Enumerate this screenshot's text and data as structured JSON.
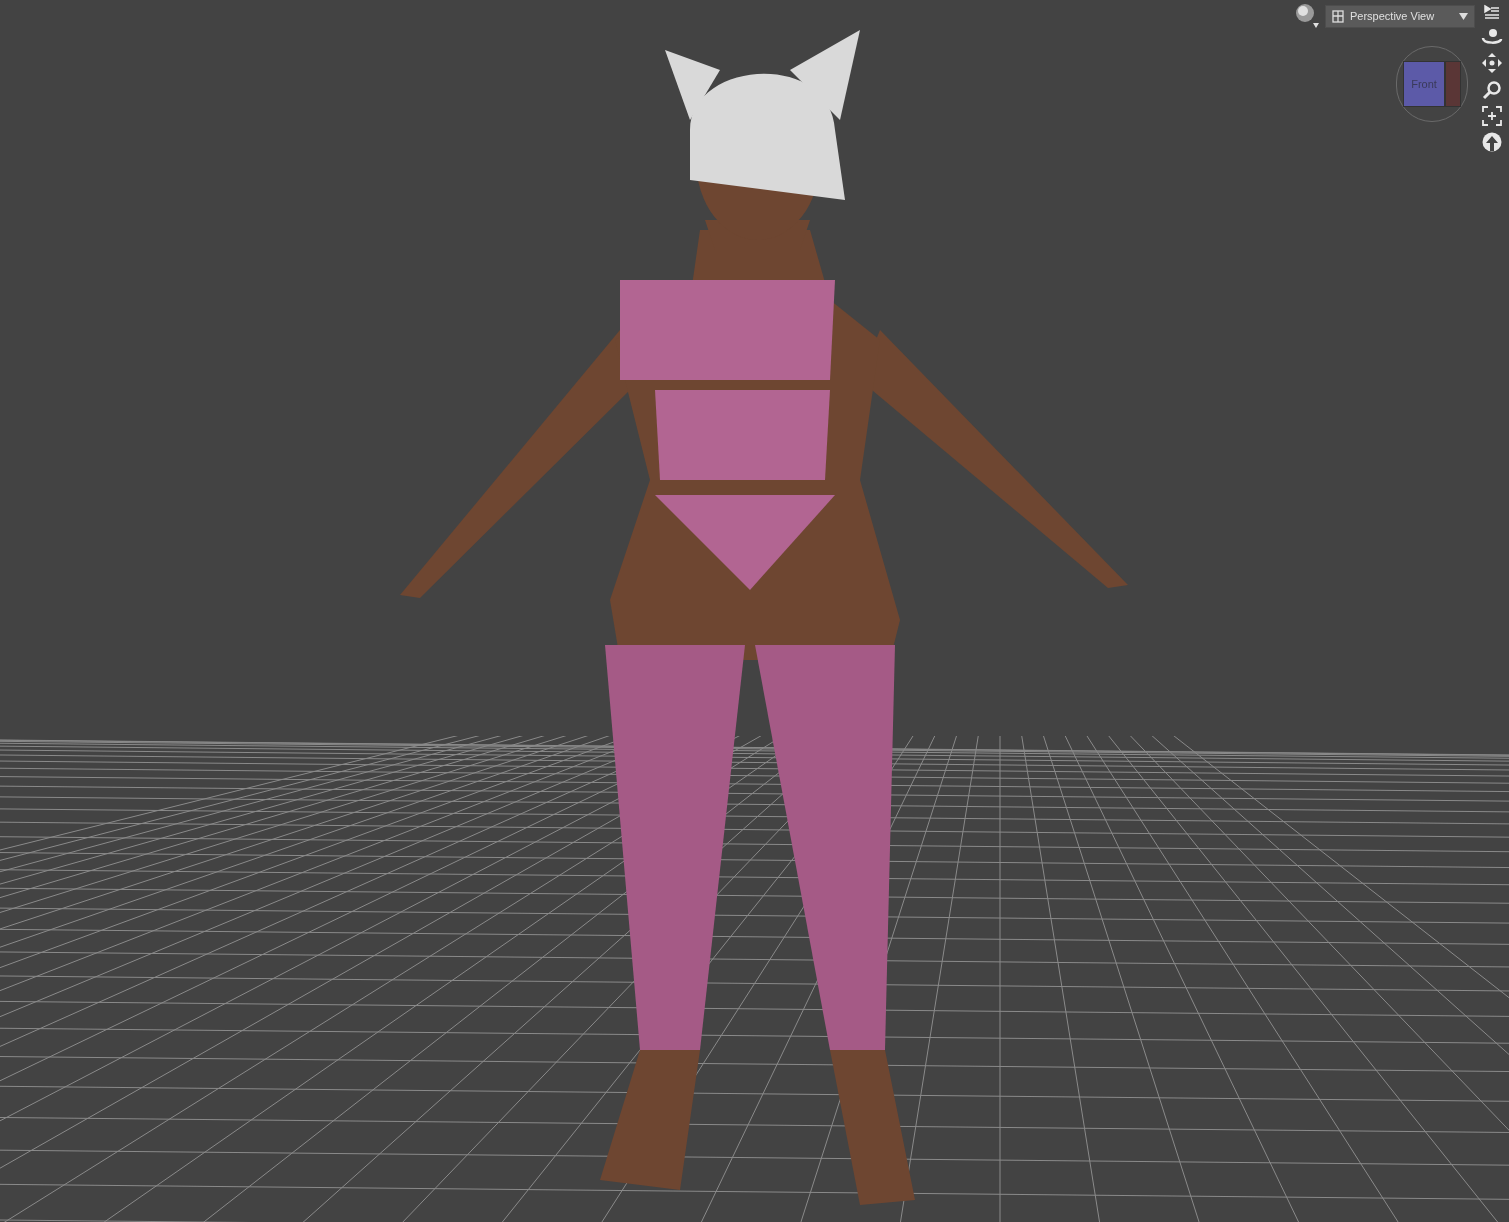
{
  "viewport": {
    "view_selector": {
      "label": "Perspective View"
    },
    "view_cube": {
      "face_label": "Front"
    }
  }
}
